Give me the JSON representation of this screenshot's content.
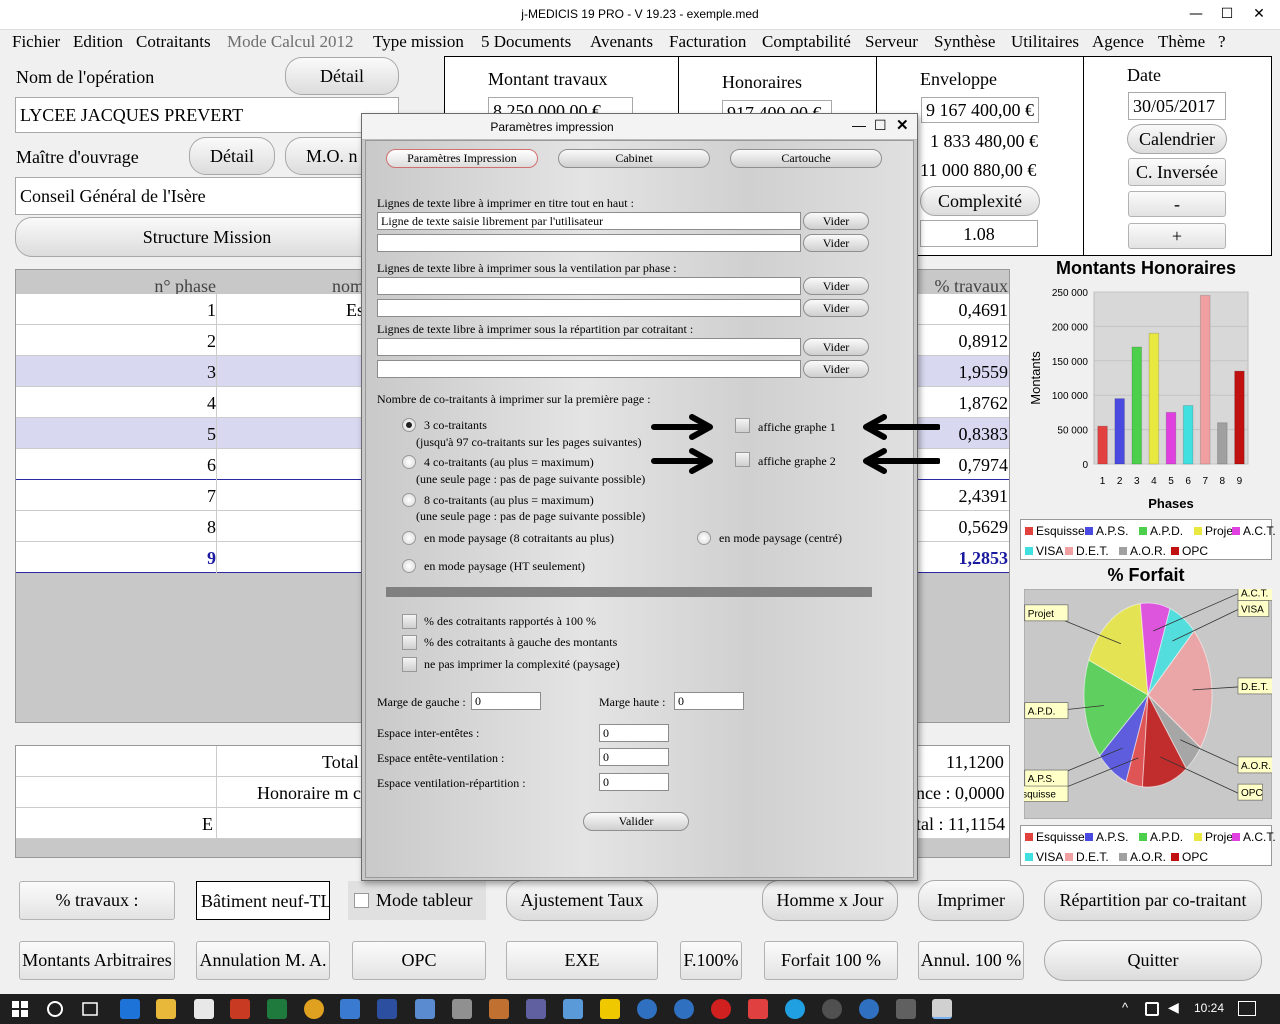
{
  "window": {
    "title": "j-MEDICIS 19 PRO - V 19.23 - exemple.med",
    "min": "—",
    "max": "☐",
    "close": "✕"
  },
  "menu": [
    {
      "label": "Fichier",
      "enabled": true
    },
    {
      "label": "Edition",
      "enabled": true
    },
    {
      "label": "Cotraitants",
      "enabled": true
    },
    {
      "label": "Mode Calcul 2012",
      "enabled": false
    },
    {
      "label": "Type mission",
      "enabled": true
    },
    {
      "label": "5 Documents",
      "enabled": true
    },
    {
      "label": "Avenants",
      "enabled": true
    },
    {
      "label": "Facturation",
      "enabled": true
    },
    {
      "label": "Comptabilité",
      "enabled": true
    },
    {
      "label": "Serveur",
      "enabled": true
    },
    {
      "label": "Synthèse",
      "enabled": true
    },
    {
      "label": "Utilitaires",
      "enabled": true
    },
    {
      "label": "Agence",
      "enabled": true
    },
    {
      "label": "Thème",
      "enabled": true
    },
    {
      "label": "?",
      "enabled": true
    }
  ],
  "operation": {
    "label": "Nom de l'opération",
    "detail": "Détail",
    "value": "LYCEE JACQUES PREVERT"
  },
  "owner": {
    "label": "Maître d'ouvrage",
    "detail": "Détail",
    "mo_button": "M.O. n",
    "value": "Conseil Général de l'Isère"
  },
  "structure_button": "Structure Mission",
  "montant": {
    "label": "Montant travaux",
    "value": "8 250 000,00 €"
  },
  "honoraires": {
    "label": "Honoraires",
    "value": "917 400,00 €"
  },
  "enveloppe": {
    "label": "Enveloppe",
    "value": "9 167 400,00 €",
    "line2": "1 833 480,00 €",
    "line3": "11 000 880,00 €",
    "complexite_btn": "Complexité",
    "complexite": "1.08"
  },
  "date": {
    "label": "Date",
    "value": "30/05/2017",
    "calendrier": "Calendrier",
    "inverse": "C. Inversée",
    "minus": "-",
    "plus": "+"
  },
  "table": {
    "headers": [
      "n° phase",
      "nom",
      "% travaux"
    ],
    "rows": [
      {
        "phase": "1",
        "name": "Es",
        "pct": "0,4691"
      },
      {
        "phase": "2",
        "name": "",
        "pct": "0,8912"
      },
      {
        "phase": "3",
        "name": "",
        "pct": "1,9559"
      },
      {
        "phase": "4",
        "name": "",
        "pct": "1,8762"
      },
      {
        "phase": "5",
        "name": "",
        "pct": "0,8383"
      },
      {
        "phase": "6",
        "name": "",
        "pct": "0,7974"
      },
      {
        "phase": "7",
        "name": "",
        "pct": "2,4391"
      },
      {
        "phase": "8",
        "name": "",
        "pct": "0,5629"
      },
      {
        "phase": "9",
        "name": "",
        "pct": "1,2853"
      }
    ]
  },
  "totals": {
    "total_label": "Total",
    "total_value": "11,1200",
    "hono_label": "Honoraire m c",
    "hono_value": "nce : 0,0000",
    "e_label": "E",
    "e_value": "tal : 11,1154"
  },
  "chart1": {
    "title": "Montants Honoraires"
  },
  "chart2": {
    "title": "% Forfait"
  },
  "legend": [
    "Esquisse",
    "A.P.S.",
    "A.P.D.",
    "Projet",
    "A.C.T.",
    "VISA",
    "D.E.T.",
    "A.O.R.",
    "OPC"
  ],
  "legend_colors": [
    "#e34040",
    "#4a4ae0",
    "#4cd04c",
    "#e8e840",
    "#e040e0",
    "#40e0e0",
    "#f0a0a0",
    "#a0a0a0",
    "#c01010"
  ],
  "chart_data": [
    {
      "type": "bar",
      "title": "Montants Honoraires",
      "xlabel": "Phases",
      "ylabel": "Montants",
      "ylim": [
        0,
        250000
      ],
      "yticks": [
        "0",
        "50 000",
        "100 000",
        "150 000",
        "200 000",
        "250 000"
      ],
      "categories": [
        "1",
        "2",
        "3",
        "4",
        "5",
        "6",
        "7",
        "8",
        "9"
      ],
      "values": [
        55000,
        95000,
        170000,
        190000,
        75000,
        85000,
        245000,
        60000,
        135000
      ]
    },
    {
      "type": "pie",
      "title": "% Forfait",
      "labels": [
        "Esquisse",
        "A.P.S.",
        "A.P.D.",
        "Projet",
        "A.C.T.",
        "VISA",
        "D.E.T.",
        "A.O.R.",
        "OPC"
      ],
      "values": [
        4.2,
        8.0,
        17.6,
        16.9,
        7.5,
        7.2,
        21.9,
        5.1,
        11.6
      ]
    }
  ],
  "bottom_row1": {
    "travaux": "% travaux :",
    "batiment": "Bâtiment neuf-TL",
    "mode_tableur": "Mode tableur",
    "ajustement": "Ajustement Taux",
    "homme_jour": "Homme x Jour",
    "imprimer": "Imprimer",
    "repartition": "Répartition par co-traitant"
  },
  "bottom_row2": {
    "montants_arb": "Montants Arbitraires",
    "annulation": "Annulation M. A.",
    "opc": "OPC",
    "exe": "EXE",
    "f100": "F.100%",
    "forfait100": "Forfait 100 %",
    "annul100": "Annul. 100 %",
    "quitter": "Quitter"
  },
  "dialog": {
    "title": "Paramètres impression",
    "tabs": [
      "Paramètres Impression",
      "Cabinet",
      "Cartouche"
    ],
    "sec1": "Lignes de texte libre à imprimer en titre tout en haut :",
    "line1": "Ligne de texte saisie librement par l'utilisateur",
    "vider": "Vider",
    "sec2": "Lignes de texte libre à imprimer sous la ventilation par phase :",
    "sec3": "Lignes de texte libre à imprimer sous la répartition par cotraitant :",
    "sec4": "Nombre de co-traitants à imprimer sur la première page :",
    "opt1": "3 co-traitants",
    "opt1b": "(jusqu'à 97 co-traitants sur les pages suivantes)",
    "opt2": "4 co-traitants (au plus = maximum)",
    "opt2b": "(une seule page : pas de page suivante possible)",
    "opt3": "8 co-traitants (au plus = maximum)",
    "opt3b": "(une seule page : pas de page suivante possible)",
    "opt4": "en mode paysage (8 cotraitants au plus)",
    "opt5": "en mode paysage (centré)",
    "opt6": "en mode paysage (HT seulement)",
    "graphe1": "affiche graphe 1",
    "graphe2": "affiche graphe 2",
    "chk1": "% des cotraitants rapportés à 100 %",
    "chk2": "% des cotraitants à gauche des montants",
    "chk3": "ne pas imprimer la complexité (paysage)",
    "marge_gauche": "Marge de gauche :",
    "marge_gauche_v": "0",
    "marge_haute": "Marge haute :",
    "marge_haute_v": "0",
    "inter": "Espace inter-entêtes :",
    "inter_v": "0",
    "entete": "Espace entête-ventilation :",
    "entete_v": "0",
    "ventil": "Espace ventilation-répartition :",
    "ventil_v": "0",
    "valider": "Valider"
  },
  "taskbar": {
    "time": "10:24"
  }
}
